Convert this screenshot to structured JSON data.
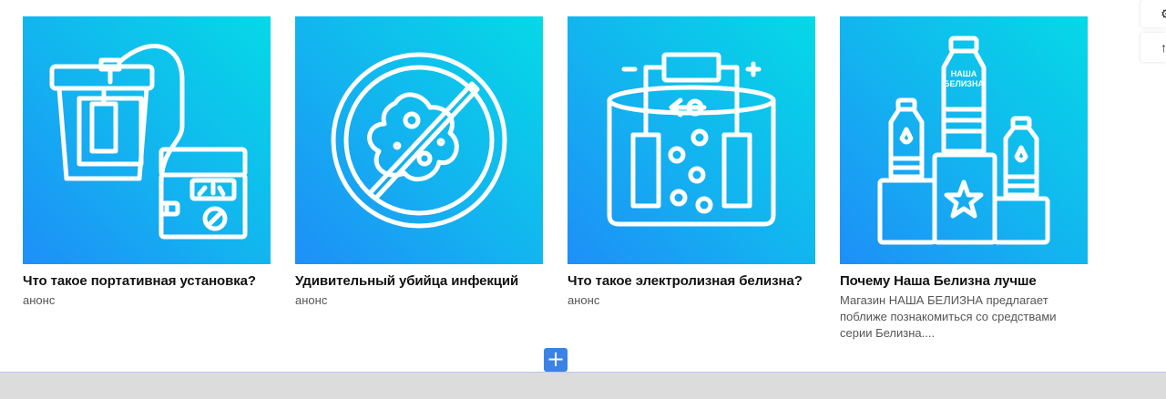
{
  "cards": [
    {
      "title": "Что такое портативная установка?",
      "desc": "анонс",
      "icon": "portable-device-icon"
    },
    {
      "title": "Удивительный убийца инфекций",
      "desc": "анонс",
      "icon": "no-bacteria-icon"
    },
    {
      "title": "Что такое электролизная белизна?",
      "desc": "анонс",
      "icon": "electrolysis-icon"
    },
    {
      "title": "Почему Наша Белизна лучше",
      "desc": "Магазин НАША БЕЛИЗНА предлагает поближе познакомиться со средствами серии Белизна....",
      "icon": "podium-bottles-icon",
      "bottle_label_line1": "НАША",
      "bottle_label_line2": "БЕЛИЗНА"
    }
  ],
  "toolbar": {
    "add_label": "+"
  },
  "colors": {
    "gradient_start": "#05d9e6",
    "gradient_end": "#1e8ff8",
    "add_button": "#3b82e6"
  }
}
